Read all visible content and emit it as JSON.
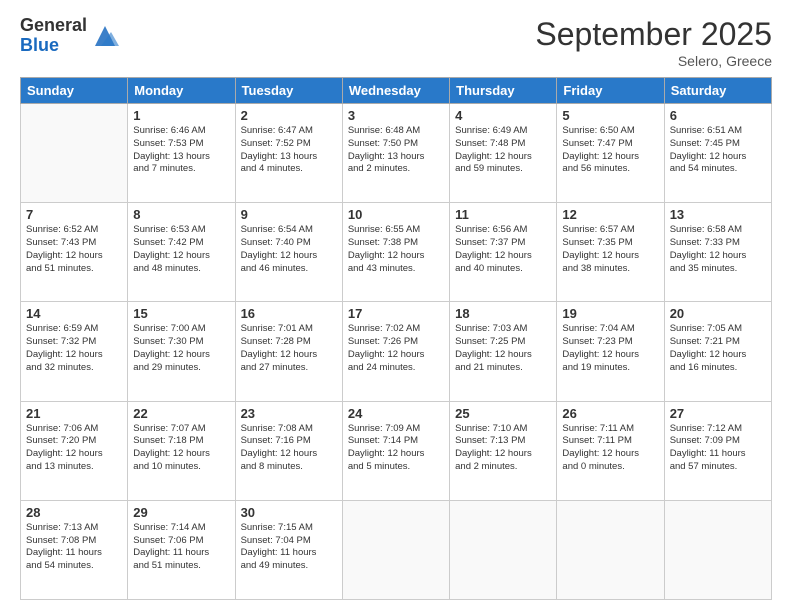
{
  "logo": {
    "line1": "General",
    "line2": "Blue"
  },
  "title": "September 2025",
  "subtitle": "Selero, Greece",
  "days_header": [
    "Sunday",
    "Monday",
    "Tuesday",
    "Wednesday",
    "Thursday",
    "Friday",
    "Saturday"
  ],
  "weeks": [
    [
      {
        "day": "",
        "info": ""
      },
      {
        "day": "1",
        "info": "Sunrise: 6:46 AM\nSunset: 7:53 PM\nDaylight: 13 hours\nand 7 minutes."
      },
      {
        "day": "2",
        "info": "Sunrise: 6:47 AM\nSunset: 7:52 PM\nDaylight: 13 hours\nand 4 minutes."
      },
      {
        "day": "3",
        "info": "Sunrise: 6:48 AM\nSunset: 7:50 PM\nDaylight: 13 hours\nand 2 minutes."
      },
      {
        "day": "4",
        "info": "Sunrise: 6:49 AM\nSunset: 7:48 PM\nDaylight: 12 hours\nand 59 minutes."
      },
      {
        "day": "5",
        "info": "Sunrise: 6:50 AM\nSunset: 7:47 PM\nDaylight: 12 hours\nand 56 minutes."
      },
      {
        "day": "6",
        "info": "Sunrise: 6:51 AM\nSunset: 7:45 PM\nDaylight: 12 hours\nand 54 minutes."
      }
    ],
    [
      {
        "day": "7",
        "info": "Sunrise: 6:52 AM\nSunset: 7:43 PM\nDaylight: 12 hours\nand 51 minutes."
      },
      {
        "day": "8",
        "info": "Sunrise: 6:53 AM\nSunset: 7:42 PM\nDaylight: 12 hours\nand 48 minutes."
      },
      {
        "day": "9",
        "info": "Sunrise: 6:54 AM\nSunset: 7:40 PM\nDaylight: 12 hours\nand 46 minutes."
      },
      {
        "day": "10",
        "info": "Sunrise: 6:55 AM\nSunset: 7:38 PM\nDaylight: 12 hours\nand 43 minutes."
      },
      {
        "day": "11",
        "info": "Sunrise: 6:56 AM\nSunset: 7:37 PM\nDaylight: 12 hours\nand 40 minutes."
      },
      {
        "day": "12",
        "info": "Sunrise: 6:57 AM\nSunset: 7:35 PM\nDaylight: 12 hours\nand 38 minutes."
      },
      {
        "day": "13",
        "info": "Sunrise: 6:58 AM\nSunset: 7:33 PM\nDaylight: 12 hours\nand 35 minutes."
      }
    ],
    [
      {
        "day": "14",
        "info": "Sunrise: 6:59 AM\nSunset: 7:32 PM\nDaylight: 12 hours\nand 32 minutes."
      },
      {
        "day": "15",
        "info": "Sunrise: 7:00 AM\nSunset: 7:30 PM\nDaylight: 12 hours\nand 29 minutes."
      },
      {
        "day": "16",
        "info": "Sunrise: 7:01 AM\nSunset: 7:28 PM\nDaylight: 12 hours\nand 27 minutes."
      },
      {
        "day": "17",
        "info": "Sunrise: 7:02 AM\nSunset: 7:26 PM\nDaylight: 12 hours\nand 24 minutes."
      },
      {
        "day": "18",
        "info": "Sunrise: 7:03 AM\nSunset: 7:25 PM\nDaylight: 12 hours\nand 21 minutes."
      },
      {
        "day": "19",
        "info": "Sunrise: 7:04 AM\nSunset: 7:23 PM\nDaylight: 12 hours\nand 19 minutes."
      },
      {
        "day": "20",
        "info": "Sunrise: 7:05 AM\nSunset: 7:21 PM\nDaylight: 12 hours\nand 16 minutes."
      }
    ],
    [
      {
        "day": "21",
        "info": "Sunrise: 7:06 AM\nSunset: 7:20 PM\nDaylight: 12 hours\nand 13 minutes."
      },
      {
        "day": "22",
        "info": "Sunrise: 7:07 AM\nSunset: 7:18 PM\nDaylight: 12 hours\nand 10 minutes."
      },
      {
        "day": "23",
        "info": "Sunrise: 7:08 AM\nSunset: 7:16 PM\nDaylight: 12 hours\nand 8 minutes."
      },
      {
        "day": "24",
        "info": "Sunrise: 7:09 AM\nSunset: 7:14 PM\nDaylight: 12 hours\nand 5 minutes."
      },
      {
        "day": "25",
        "info": "Sunrise: 7:10 AM\nSunset: 7:13 PM\nDaylight: 12 hours\nand 2 minutes."
      },
      {
        "day": "26",
        "info": "Sunrise: 7:11 AM\nSunset: 7:11 PM\nDaylight: 12 hours\nand 0 minutes."
      },
      {
        "day": "27",
        "info": "Sunrise: 7:12 AM\nSunset: 7:09 PM\nDaylight: 11 hours\nand 57 minutes."
      }
    ],
    [
      {
        "day": "28",
        "info": "Sunrise: 7:13 AM\nSunset: 7:08 PM\nDaylight: 11 hours\nand 54 minutes."
      },
      {
        "day": "29",
        "info": "Sunrise: 7:14 AM\nSunset: 7:06 PM\nDaylight: 11 hours\nand 51 minutes."
      },
      {
        "day": "30",
        "info": "Sunrise: 7:15 AM\nSunset: 7:04 PM\nDaylight: 11 hours\nand 49 minutes."
      },
      {
        "day": "",
        "info": ""
      },
      {
        "day": "",
        "info": ""
      },
      {
        "day": "",
        "info": ""
      },
      {
        "day": "",
        "info": ""
      }
    ]
  ]
}
